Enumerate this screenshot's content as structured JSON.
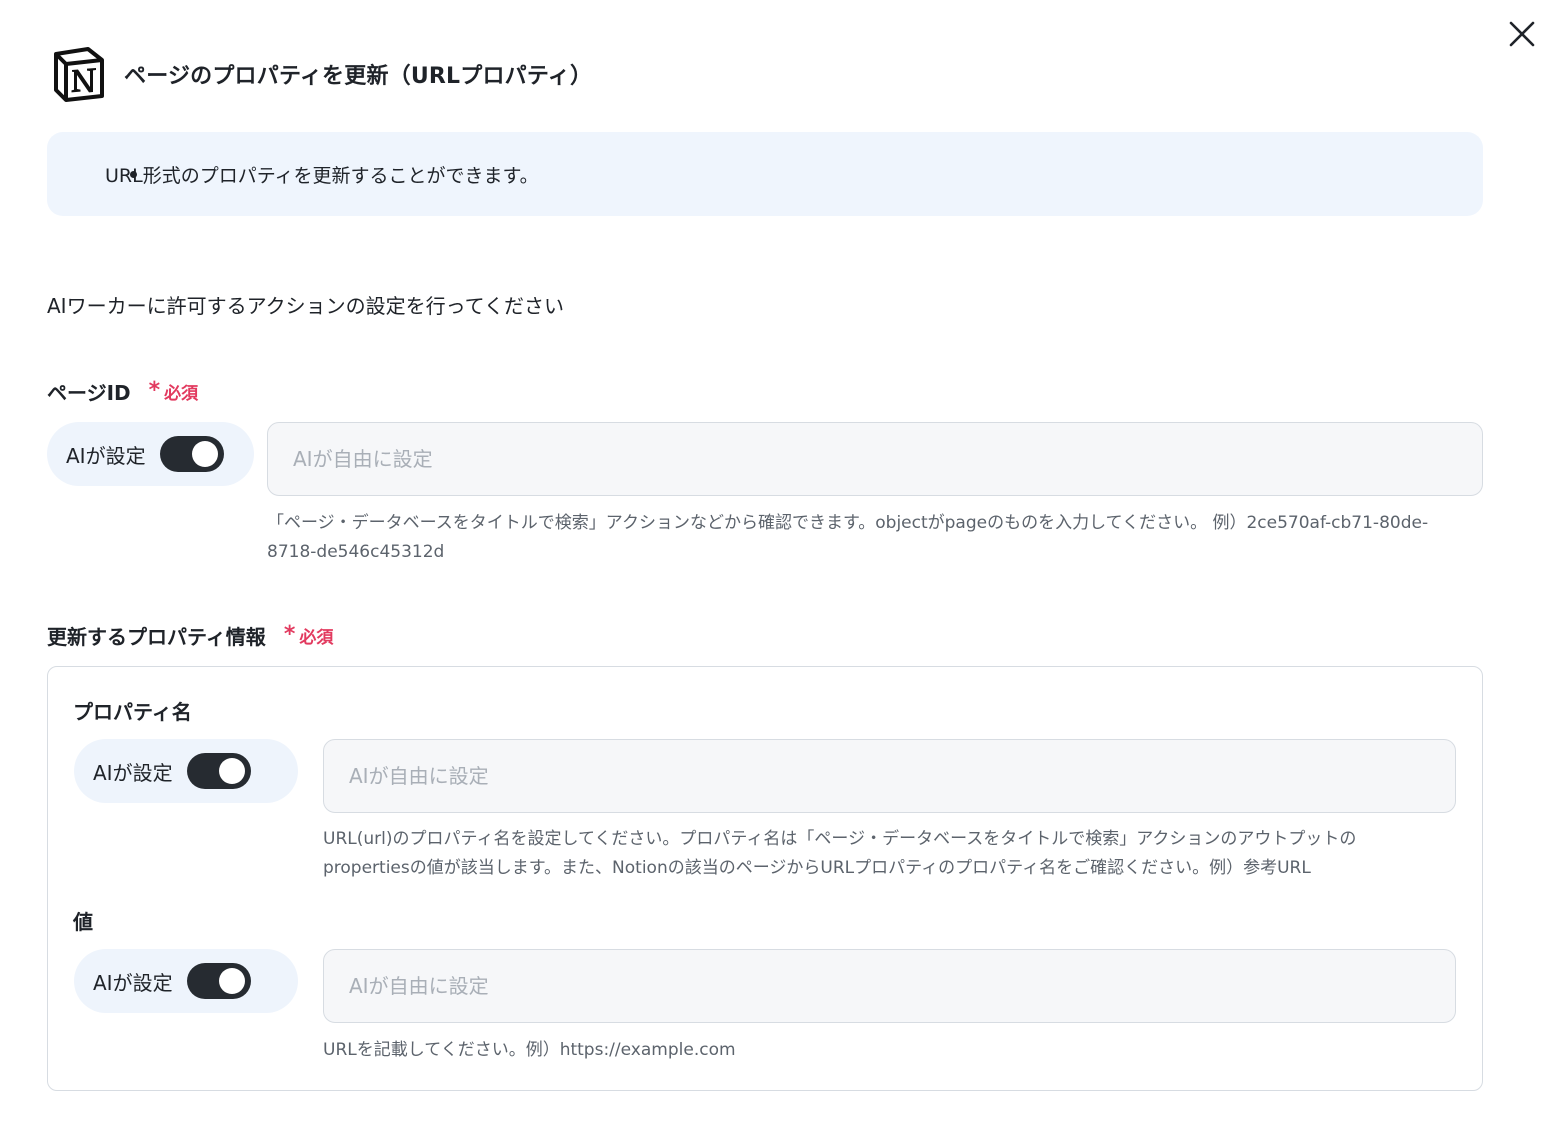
{
  "modal": {
    "title": "ページのプロパティを更新（URLプロパティ）",
    "close_icon": "close-icon",
    "logo_icon": "notion-logo-icon"
  },
  "info": {
    "items": [
      "URL形式のプロパティを更新することができます。"
    ]
  },
  "intro": "AIワーカーに許可するアクションの設定を行ってください",
  "required_text": "必須",
  "required_mark": "*",
  "page_id": {
    "label": "ページID",
    "ai_toggle_label": "AIが設定",
    "ai_toggle_on": true,
    "placeholder": "AIが自由に設定",
    "value": "",
    "help": "「ページ・データベースをタイトルで検索」アクションなどから確認できます。objectがpageのものを入力してください。 例）2ce570af-cb71-80de-8718-de546c45312d"
  },
  "properties": {
    "label": "更新するプロパティ情報",
    "property_name": {
      "label": "プロパティ名",
      "ai_toggle_label": "AIが設定",
      "ai_toggle_on": true,
      "placeholder": "AIが自由に設定",
      "value": "",
      "help": "URL(url)のプロパティ名を設定してください。プロパティ名は「ページ・データベースをタイトルで検索」アクションのアウトプットのpropertiesの値が該当します。また、Notionの該当のページからURLプロパティのプロパティ名をご確認ください。例）参考URL"
    },
    "value_field": {
      "label": "値",
      "ai_toggle_label": "AIが設定",
      "ai_toggle_on": true,
      "placeholder": "AIが自由に設定",
      "value": "",
      "help": "URLを記載してください。例）https://example.com"
    }
  }
}
